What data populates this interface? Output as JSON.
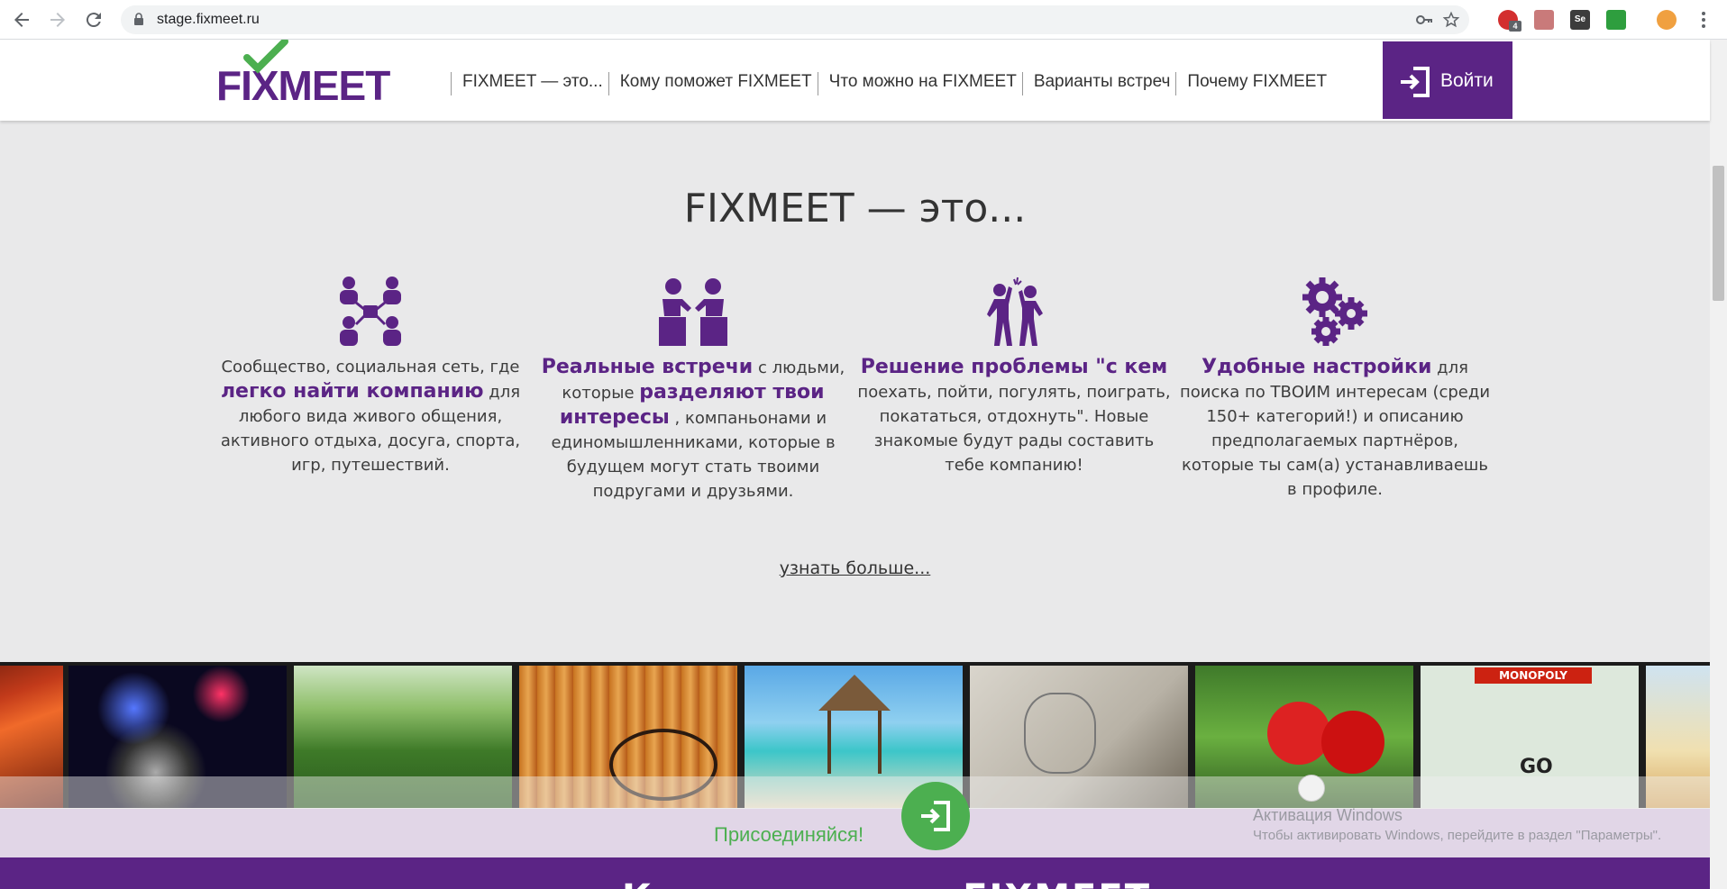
{
  "browser": {
    "url": "stage.fixmeet.ru",
    "back_icon": "arrow-left",
    "forward_icon": "arrow-right",
    "reload_icon": "reload",
    "key_icon": "key",
    "star_icon": "star",
    "menu_icon": "kebab-menu",
    "extension_badge": "4",
    "extension_se": "Se"
  },
  "header": {
    "logo": "FIXMEET",
    "menu": [
      {
        "label": "FIXMEET — это..."
      },
      {
        "label": "Кому поможет FIXMEET"
      },
      {
        "label": "Что можно на FIXMEET"
      },
      {
        "label": "Варианты встреч"
      },
      {
        "label": "Почему FIXMEET"
      }
    ],
    "login_label": "Войти"
  },
  "section": {
    "title": "FIXMEET — это...",
    "features": [
      {
        "icon": "network-people-icon",
        "pre": "Сообщество, социальная сеть, где",
        "highlight": "легко найти компанию",
        "post": "для любого вида живого общения, активного отдыха, досуга, спорта, игр, путешествий."
      },
      {
        "icon": "meeting-people-icon",
        "highlight": "Реальные встречи",
        "mid": "с людьми, которые",
        "highlight2": "разделяют твои интересы",
        "post": ", компаньонами и единомышленниками, которые в будущем могут стать твоими подругами и друзьями."
      },
      {
        "icon": "high-five-icon",
        "highlight": "Решение проблемы \"с кем",
        "post": "поехать, пойти, погулять, поиграть, покататься, отдохнуть\". Новые знакомые будут рады составить тебе компанию!"
      },
      {
        "icon": "gears-icon",
        "highlight": "Удобные настройки",
        "post": "для поиска по ТВОИМ интересам (среди 150+ категорий!) и описанию предполагаемых партнёров, которые ты сам(а) устанавливаешь в профиле."
      }
    ],
    "more_link": "узнать больше..."
  },
  "strip": {
    "photos": [
      "concert-stage",
      "microphone",
      "cycling-field",
      "badminton",
      "beach-gazebo",
      "drawing",
      "table-tennis",
      "monopoly",
      "lake"
    ],
    "monopoly_text": "MONOPOLY",
    "go_text": "GO"
  },
  "join": {
    "label": "Присоединяйся!"
  },
  "windows": {
    "line1": "Активация Windows",
    "line2": "Чтобы активировать Windows, перейдите в раздел \"Параметры\"."
  },
  "footer": {
    "cut_text": "Кому поможет FIXMEET"
  },
  "colors": {
    "brand_purple": "#5b2485",
    "join_green": "#4caf50",
    "background": "#e9e9ea"
  }
}
